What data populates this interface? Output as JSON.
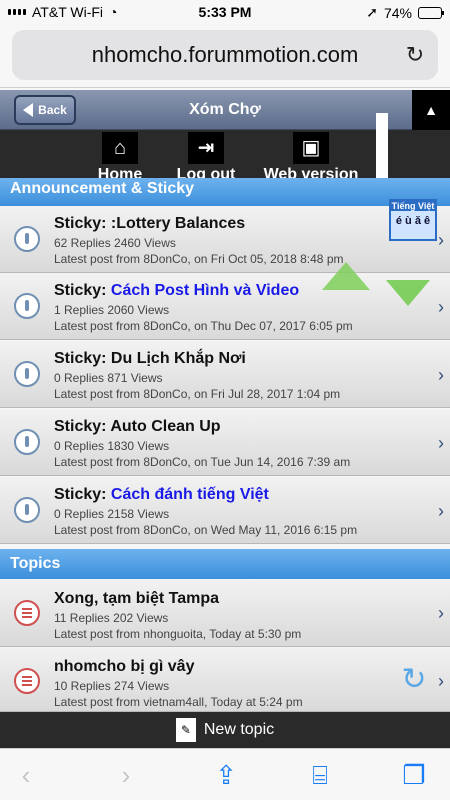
{
  "status": {
    "carrier": "AT&T Wi-Fi",
    "time": "5:33 PM",
    "battery": "74%",
    "battery_level": 0.74
  },
  "browser": {
    "url": "nhomcho.forummotion.com"
  },
  "forum": {
    "back_label": "Back",
    "title": "Xóm Chợ",
    "collapse_symbol": "▲"
  },
  "menu": {
    "home": "Home",
    "logout": "Log out",
    "web_version": "Web version"
  },
  "sections": {
    "announcement": "Announcement & Sticky",
    "topics": "Topics"
  },
  "widget": {
    "viet_title": "Tiếng Việt",
    "viet_keys": "é ù ă ê"
  },
  "stickies": [
    {
      "prefix": "Sticky:",
      "title": ":Lottery Balances",
      "title_is_link": false,
      "meta": "62 Replies 2460 Views",
      "latest": "Latest post from 8DonCo, on Fri Oct 05, 2018 8:48 pm"
    },
    {
      "prefix": "Sticky:",
      "title": "Cách Post Hình và Video",
      "title_is_link": true,
      "meta": "1 Replies 2060 Views",
      "latest": "Latest post from 8DonCo, on Thu Dec 07, 2017 6:05 pm"
    },
    {
      "prefix": "Sticky:",
      "title": "Du Lịch Khắp Nơi",
      "title_is_link": false,
      "meta": "0 Replies 871 Views",
      "latest": "Latest post from 8DonCo, on Fri Jul 28, 2017 1:04 pm"
    },
    {
      "prefix": "Sticky:",
      "title": "Auto Clean Up",
      "title_is_link": false,
      "meta": "0 Replies 1830 Views",
      "latest": "Latest post from 8DonCo, on Tue Jun 14, 2016 7:39 am"
    },
    {
      "prefix": "Sticky:",
      "title": "Cách đánh tiếng Việt",
      "title_is_link": true,
      "meta": "0 Replies 2158 Views",
      "latest": "Latest post from 8DonCo, on Wed May 11, 2016 6:15 pm"
    }
  ],
  "topics": [
    {
      "title": "Xong, tạm biệt Tampa",
      "meta": "11 Replies 202 Views",
      "latest": "Latest post from nhonguoita, Today at 5:30 pm"
    },
    {
      "title": "nhomcho bị gì vây",
      "meta": "10 Replies 274 Views",
      "latest": "Latest post from vietnam4all, Today at 5:24 pm"
    }
  ],
  "footer": {
    "new_topic": "New topic"
  },
  "icons": [
    "wifi-icon",
    "location-icon",
    "battery-icon",
    "reload-icon",
    "back-arrow-icon",
    "home-icon",
    "logout-icon",
    "web-version-icon",
    "sticky-icon",
    "topic-icon",
    "chevron-right-icon",
    "refresh-icon",
    "new-topic-icon",
    "safari-back-icon",
    "safari-forward-icon",
    "share-icon",
    "bookmarks-icon",
    "tabs-icon"
  ]
}
